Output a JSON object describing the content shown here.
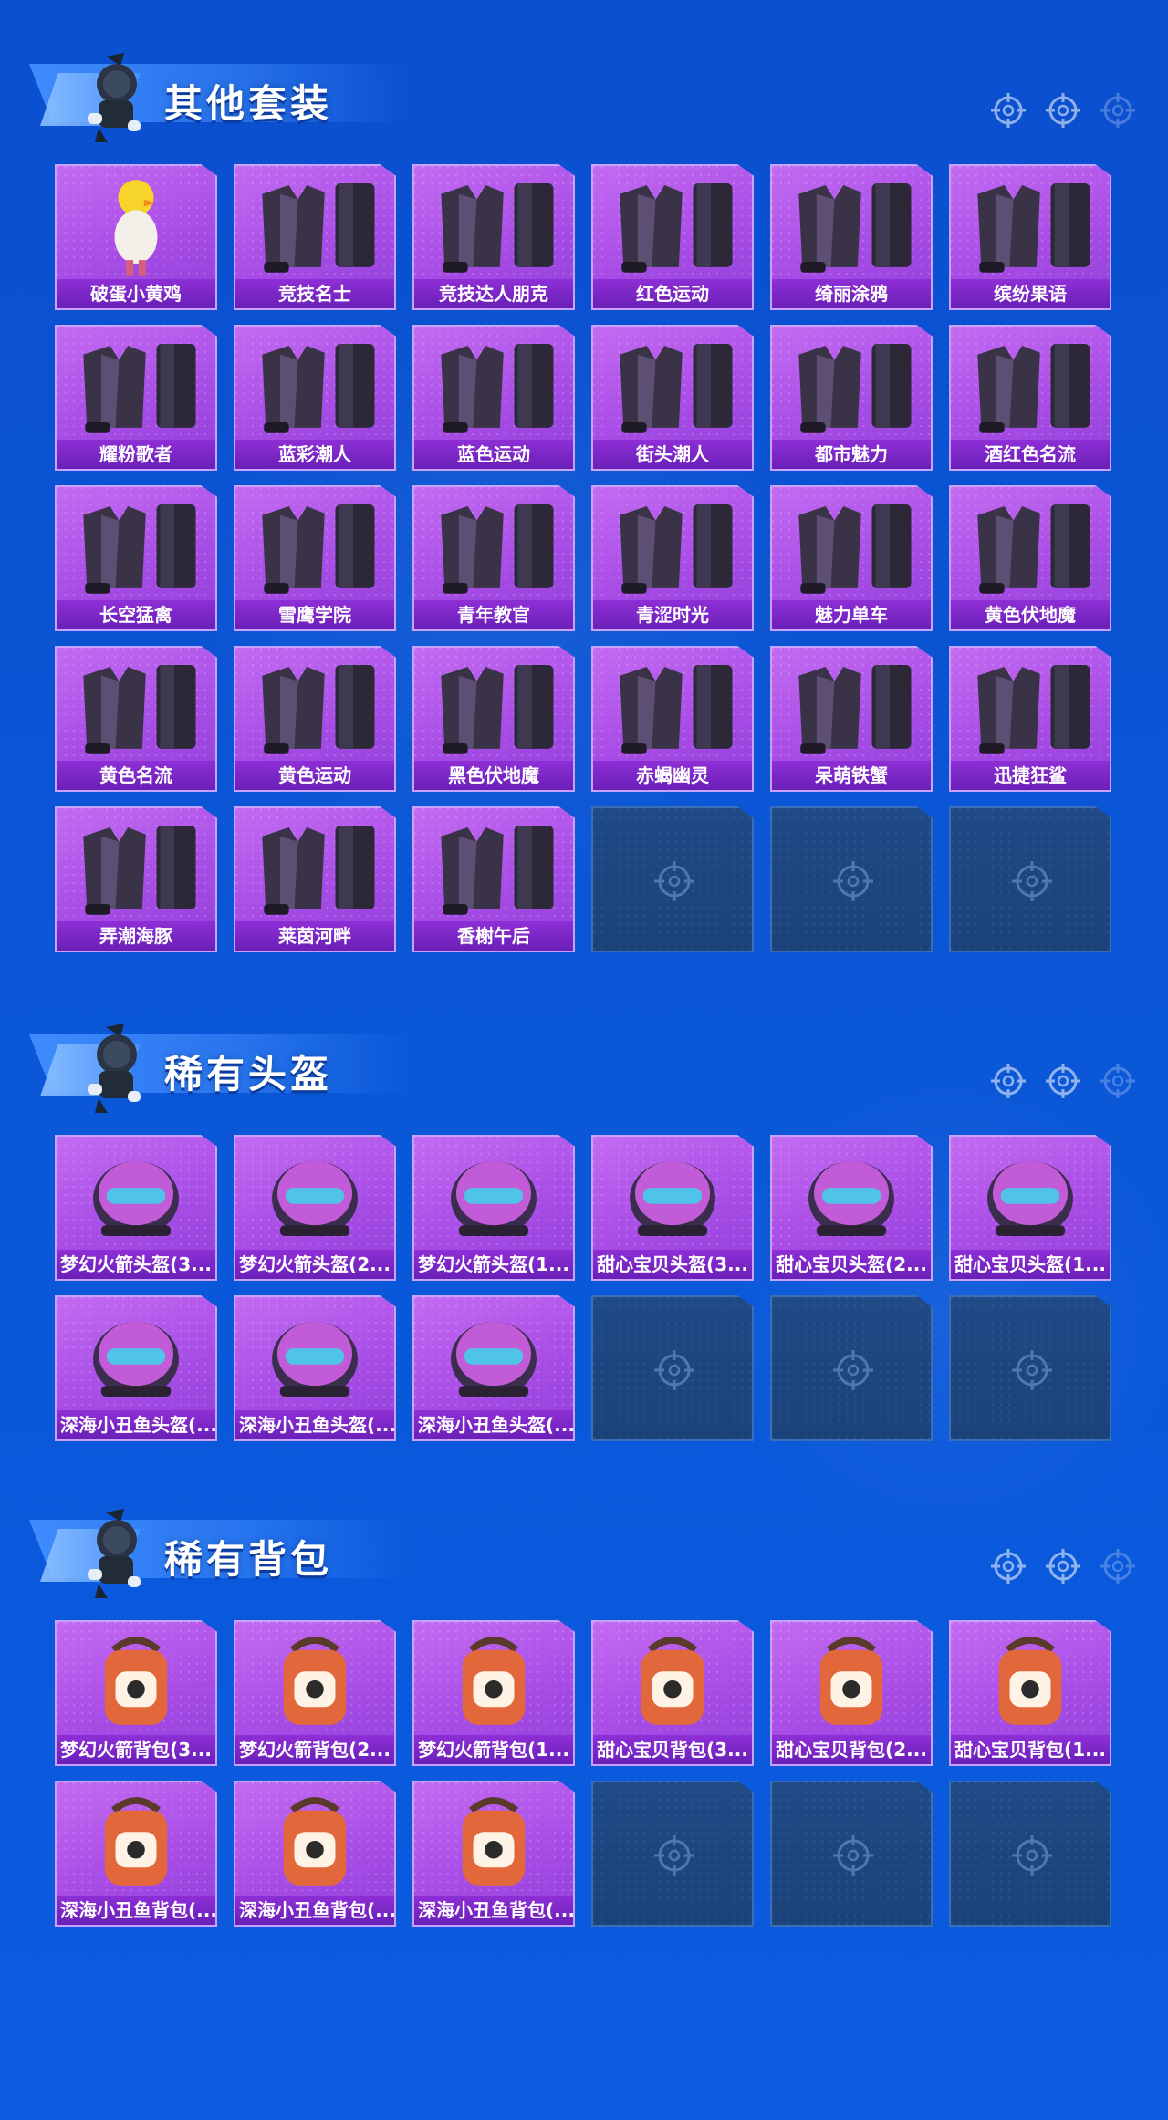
{
  "sections": [
    {
      "title": "其他套装",
      "items": [
        {
          "label": "破蛋小黄鸡",
          "icon": "chick-costume-icon"
        },
        {
          "label": "竞技名士",
          "icon": "jacket-outfit-icon"
        },
        {
          "label": "竞技达人朋克",
          "icon": "jacket-outfit-icon"
        },
        {
          "label": "红色运动",
          "icon": "jacket-outfit-icon"
        },
        {
          "label": "绮丽涂鸦",
          "icon": "jacket-outfit-icon"
        },
        {
          "label": "缤纷果语",
          "icon": "jacket-outfit-icon"
        },
        {
          "label": "耀粉歌者",
          "icon": "jacket-outfit-icon"
        },
        {
          "label": "蓝彩潮人",
          "icon": "jacket-outfit-icon"
        },
        {
          "label": "蓝色运动",
          "icon": "jacket-outfit-icon"
        },
        {
          "label": "街头潮人",
          "icon": "jacket-outfit-icon"
        },
        {
          "label": "都市魅力",
          "icon": "jacket-outfit-icon"
        },
        {
          "label": "酒红色名流",
          "icon": "jacket-outfit-icon"
        },
        {
          "label": "长空猛禽",
          "icon": "jacket-outfit-icon"
        },
        {
          "label": "雪鹰学院",
          "icon": "jacket-outfit-icon"
        },
        {
          "label": "青年教官",
          "icon": "jacket-outfit-icon"
        },
        {
          "label": "青涩时光",
          "icon": "jacket-outfit-icon"
        },
        {
          "label": "魅力单车",
          "icon": "jacket-outfit-icon"
        },
        {
          "label": "黄色伏地魔",
          "icon": "jacket-outfit-icon"
        },
        {
          "label": "黄色名流",
          "icon": "jacket-outfit-icon"
        },
        {
          "label": "黄色运动",
          "icon": "jacket-outfit-icon"
        },
        {
          "label": "黑色伏地魔",
          "icon": "jacket-outfit-icon"
        },
        {
          "label": "赤蝎幽灵",
          "icon": "jacket-outfit-icon"
        },
        {
          "label": "呆萌铁蟹",
          "icon": "jacket-outfit-icon"
        },
        {
          "label": "迅捷狂鲨",
          "icon": "jacket-outfit-icon"
        },
        {
          "label": "弄潮海豚",
          "icon": "jacket-outfit-icon"
        },
        {
          "label": "莱茵河畔",
          "icon": "jacket-outfit-icon"
        },
        {
          "label": "香榭午后",
          "icon": "jacket-outfit-icon"
        }
      ],
      "empty_slots": 3
    },
    {
      "title": "稀有头盔",
      "items": [
        {
          "label": "梦幻火箭头盔(3...",
          "icon": "helmet-icon"
        },
        {
          "label": "梦幻火箭头盔(2...",
          "icon": "helmet-icon"
        },
        {
          "label": "梦幻火箭头盔(1...",
          "icon": "helmet-icon"
        },
        {
          "label": "甜心宝贝头盔(3...",
          "icon": "helmet-icon"
        },
        {
          "label": "甜心宝贝头盔(2...",
          "icon": "helmet-icon"
        },
        {
          "label": "甜心宝贝头盔(1...",
          "icon": "helmet-icon"
        },
        {
          "label": "深海小丑鱼头盔(...",
          "icon": "helmet-icon"
        },
        {
          "label": "深海小丑鱼头盔(...",
          "icon": "helmet-icon"
        },
        {
          "label": "深海小丑鱼头盔(...",
          "icon": "helmet-icon"
        }
      ],
      "empty_slots": 3
    },
    {
      "title": "稀有背包",
      "items": [
        {
          "label": "梦幻火箭背包(3...",
          "icon": "backpack-icon"
        },
        {
          "label": "梦幻火箭背包(2...",
          "icon": "backpack-icon"
        },
        {
          "label": "梦幻火箭背包(1...",
          "icon": "backpack-icon"
        },
        {
          "label": "甜心宝贝背包(3...",
          "icon": "backpack-icon"
        },
        {
          "label": "甜心宝贝背包(2...",
          "icon": "backpack-icon"
        },
        {
          "label": "甜心宝贝背包(1...",
          "icon": "backpack-icon"
        },
        {
          "label": "深海小丑鱼背包(...",
          "icon": "backpack-icon"
        },
        {
          "label": "深海小丑鱼背包(...",
          "icon": "backpack-icon"
        },
        {
          "label": "深海小丑鱼背包(...",
          "icon": "backpack-icon"
        }
      ],
      "empty_slots": 3
    }
  ],
  "colors": {
    "background": "#0a52d4",
    "card": "#a84de6",
    "card_label": "#7a25c6",
    "empty_slot": "#1d457f",
    "accent": "#8ec2ff"
  }
}
